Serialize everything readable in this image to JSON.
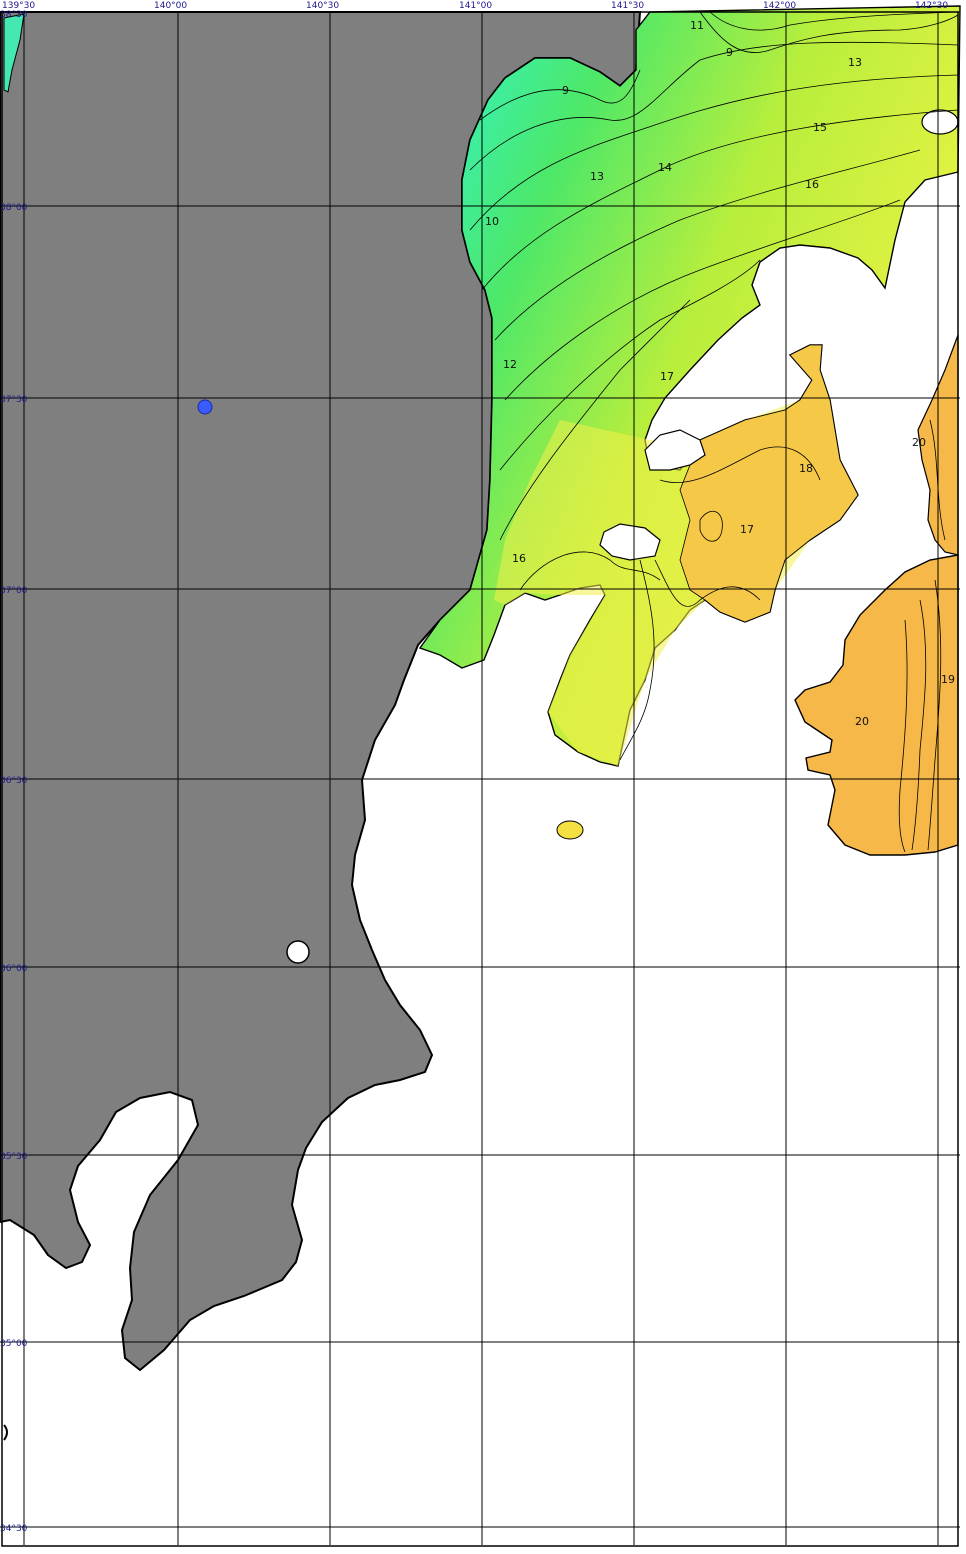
{
  "map": {
    "lon_ticks": [
      "139°30",
      "140°00",
      "140°30",
      "141°00",
      "141°30",
      "142°00",
      "142°30"
    ],
    "lat_ticks": [
      "38°30",
      "38°00",
      "37°30",
      "37°00",
      "36°30",
      "36°00",
      "35°30",
      "35°00",
      "34°30"
    ],
    "isotherm_labels": [
      {
        "id": "iso-9a",
        "text": "9"
      },
      {
        "id": "iso-9b",
        "text": "9"
      },
      {
        "id": "iso-10",
        "text": "10"
      },
      {
        "id": "iso-11",
        "text": "11"
      },
      {
        "id": "iso-12",
        "text": "12"
      },
      {
        "id": "iso-13a",
        "text": "13"
      },
      {
        "id": "iso-13b",
        "text": "13"
      },
      {
        "id": "iso-14",
        "text": "14"
      },
      {
        "id": "iso-15",
        "text": "15"
      },
      {
        "id": "iso-16a",
        "text": "16"
      },
      {
        "id": "iso-16b",
        "text": "16"
      },
      {
        "id": "iso-17a",
        "text": "17"
      },
      {
        "id": "iso-17b",
        "text": "17"
      },
      {
        "id": "iso-18",
        "text": "18"
      },
      {
        "id": "iso-19",
        "text": "19"
      },
      {
        "id": "iso-20a",
        "text": "20"
      },
      {
        "id": "iso-20b",
        "text": "20"
      }
    ],
    "colors": {
      "land": "#7f7f7f",
      "no_data": "#ffffff",
      "temp_9_10": "#38f0c8",
      "temp_11_13": "#40e060",
      "temp_14_15": "#a8ec40",
      "temp_16_17": "#f4f040",
      "temp_18": "#f8c848",
      "temp_19_20": "#f4b040",
      "marker": "#3a5cff"
    }
  }
}
